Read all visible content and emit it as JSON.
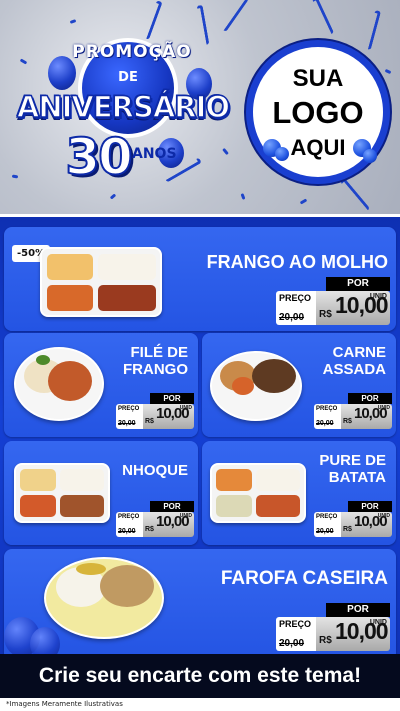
{
  "badge": {
    "promo_word": "PROMOÇÃO",
    "de_word": "DE",
    "aniversario_word": "ANIVERSÁRIO",
    "number": "30",
    "anos_word": "ANOS"
  },
  "logo": {
    "line1": "SUA",
    "line2": "LOGO",
    "line3": "AQUI"
  },
  "colors": {
    "primary_blue": "#1540d4",
    "card_blue": "#2f61ec",
    "dark": "#050a1e"
  },
  "products": [
    {
      "title": "FRANGO AO MOLHO",
      "discount": "-50%",
      "price_label": "PREÇO",
      "old_price": "20,00",
      "por": "POR",
      "currency": "R$",
      "price": "10,00",
      "unit": "UNID"
    },
    {
      "title_line1": "FILÉ DE",
      "title_line2": "FRANGO",
      "price_label": "PREÇO",
      "old_price": "20,00",
      "por": "POR",
      "currency": "R$",
      "price": "10,00",
      "unit": "UNID"
    },
    {
      "title_line1": "CARNE",
      "title_line2": "ASSADA",
      "price_label": "PREÇO",
      "old_price": "20,00",
      "por": "POR",
      "currency": "R$",
      "price": "10,00",
      "unit": "UNID"
    },
    {
      "title": "NHOQUE",
      "price_label": "PREÇO",
      "old_price": "20,00",
      "por": "POR",
      "currency": "R$",
      "price": "10,00",
      "unit": "UNID"
    },
    {
      "title_line1": "PURE DE",
      "title_line2": "BATATA",
      "price_label": "PREÇO",
      "old_price": "20,00",
      "por": "POR",
      "currency": "R$",
      "price": "10,00",
      "unit": "UNID"
    },
    {
      "title": "FAROFA CASEIRA",
      "price_label": "PREÇO",
      "old_price": "20,00",
      "por": "POR",
      "currency": "R$",
      "price": "10,00",
      "unit": "UNID"
    }
  ],
  "cta": "Crie seu encarte com este tema!",
  "disclaimer": "*Imagens Meramente Ilustrativas"
}
